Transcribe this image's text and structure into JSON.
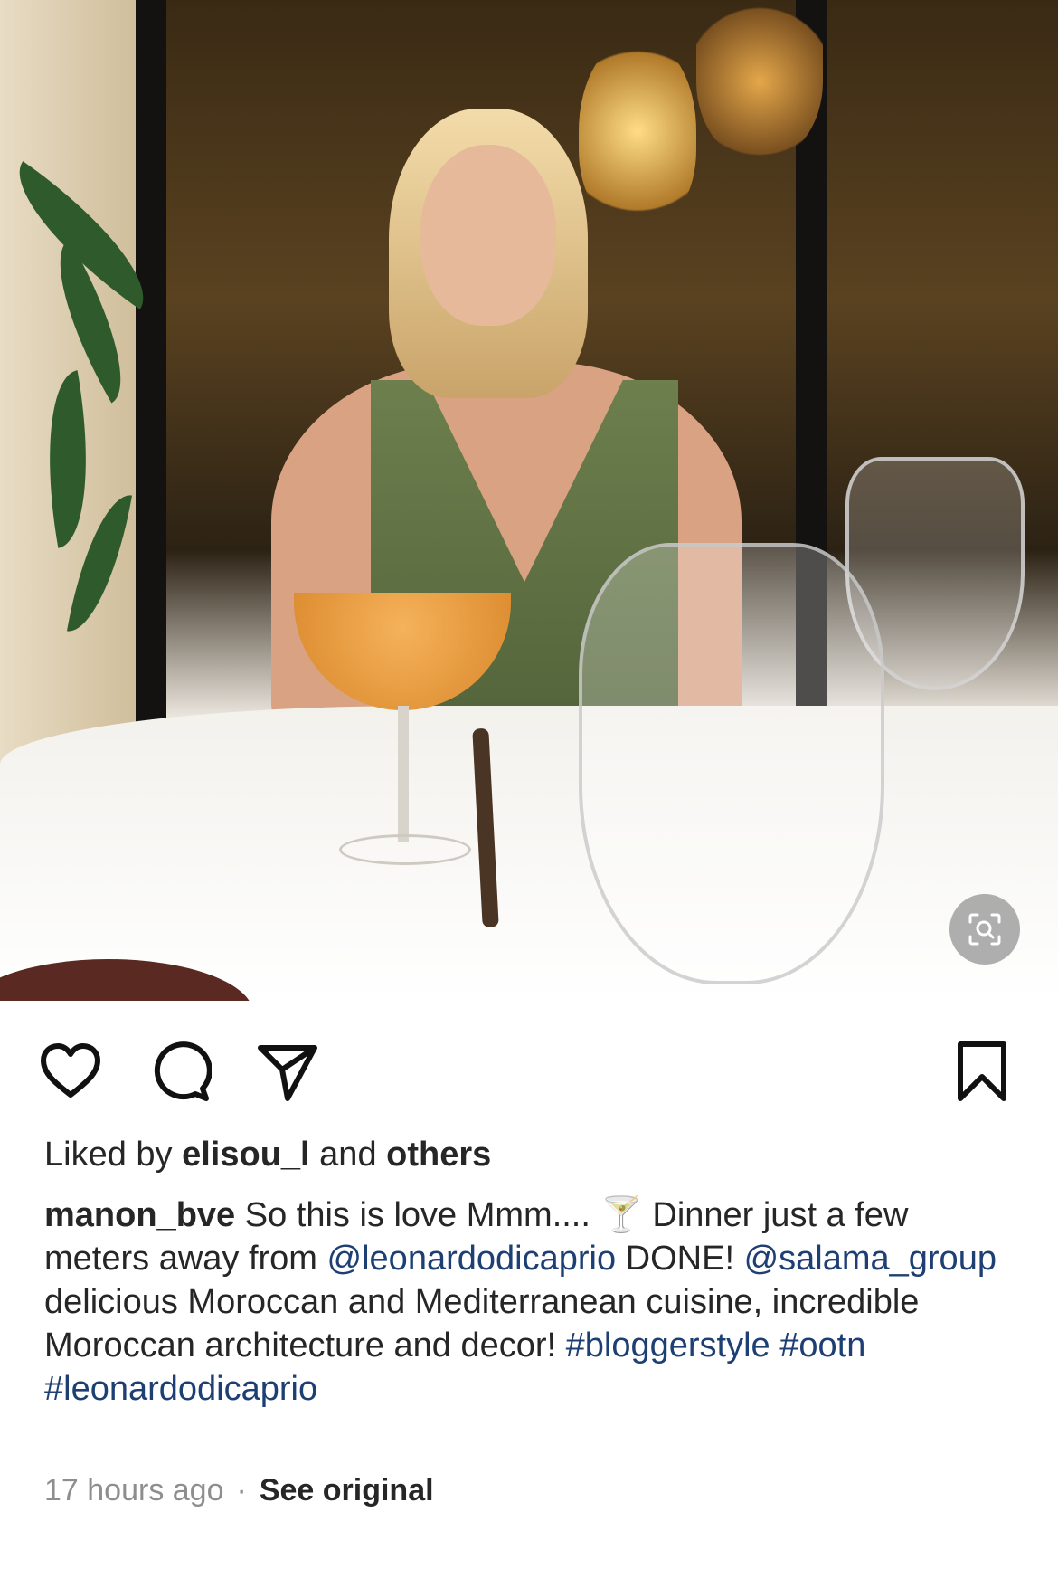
{
  "post": {
    "photo_alt": "",
    "likes": {
      "prefix": "Liked by",
      "user": "elisou_l",
      "middle": "and",
      "suffix": "others"
    },
    "caption": {
      "username": "manon_bve",
      "part1": " So this is love Mmm.... ",
      "emoji": "🍸",
      "part2": " Dinner just a few meters away from ",
      "mention1": "@leonardodicaprio",
      "part3": " DONE! ",
      "mention2": "@salama_group",
      "part4": " delicious Moroccan and Mediterranean cuisine, incredible Moroccan architecture and decor! ",
      "tag1": "#bloggerstyle",
      "tag2": "#ootn",
      "tag3": "#leonardodicaprio"
    },
    "meta": {
      "time": "17 hours ago",
      "separator": "·",
      "see_original": "See original"
    }
  },
  "icons": {
    "like": "heart-icon",
    "comment": "comment-bubble-icon",
    "share": "paper-plane-icon",
    "save": "bookmark-icon",
    "lens": "visual-search-icon"
  },
  "colors": {
    "text": "#262626",
    "link": "#1e3f73",
    "muted": "#8e8e8e"
  }
}
